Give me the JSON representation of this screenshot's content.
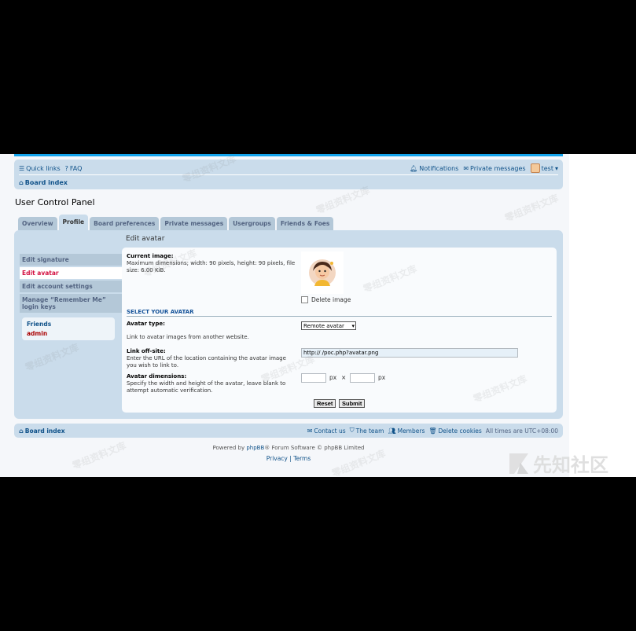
{
  "nav": {
    "quick_links": "Quick links",
    "faq": "FAQ",
    "notifications": "Notifications",
    "private_messages": "Private messages",
    "username": "test",
    "board_index": "Board index"
  },
  "page_title": "User Control Panel",
  "tabs": [
    {
      "label": "Overview"
    },
    {
      "label": "Profile"
    },
    {
      "label": "Board preferences"
    },
    {
      "label": "Private messages"
    },
    {
      "label": "Usergroups"
    },
    {
      "label": "Friends & Foes"
    }
  ],
  "sidebar": {
    "items": [
      {
        "label": "Edit signature"
      },
      {
        "label": "Edit avatar"
      },
      {
        "label": "Edit account settings"
      },
      {
        "label": "Manage “Remember Me” login keys"
      }
    ],
    "friends_title": "Friends",
    "friend_user": "admin"
  },
  "form": {
    "heading": "Edit avatar",
    "current_image_label": "Current image:",
    "current_image_explain": "Maximum dimensions; width: 90 pixels, height: 90 pixels, file size: 6.00 KiB.",
    "delete_image_label": "Delete image",
    "section_title": "SELECT YOUR AVATAR",
    "avatar_type_label": "Avatar type:",
    "avatar_type_value": "Remote avatar",
    "remote_explain": "Link to avatar images from another website.",
    "link_label": "Link off-site:",
    "link_explain": "Enter the URL of the location containing the avatar image you wish to link to.",
    "link_value": "http://                    /poc.php?avatar.png",
    "dims_label": "Avatar dimensions:",
    "dims_explain": "Specify the width and height of the avatar, leave blank to attempt automatic verification.",
    "px": "px",
    "times": "×",
    "reset_label": "Reset",
    "submit_label": "Submit"
  },
  "footer": {
    "board_index": "Board index",
    "contact": "Contact us",
    "team": "The team",
    "members": "Members",
    "delete_cookies": "Delete cookies",
    "timezone": "All times are UTC+08:00",
    "powered_prefix": "Powered by ",
    "phpbb": "phpBB",
    "powered_suffix": "® Forum Software © phpBB Limited",
    "privacy": "Privacy",
    "separator": "|",
    "terms": "Terms"
  },
  "watermark_text": "零组资料文库",
  "logo_text": "先知社区",
  "colors": {
    "accent": "#105289",
    "panel": "#cadceb",
    "active_red": "#d31141",
    "stripe": "#12a3eb"
  }
}
